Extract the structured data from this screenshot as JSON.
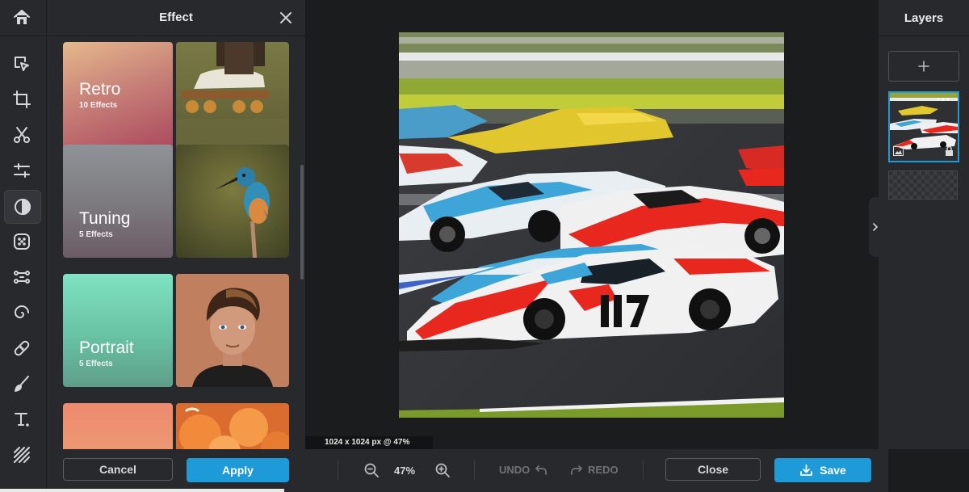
{
  "effect_panel": {
    "title": "Effect",
    "categories": [
      {
        "name": "Retro",
        "count": "10 Effects"
      },
      {
        "name": "Tuning",
        "count": "5 Effects"
      },
      {
        "name": "Portrait",
        "count": "5 Effects"
      }
    ],
    "cancel_label": "Cancel",
    "apply_label": "Apply"
  },
  "canvas": {
    "dimensions_label": "1024 x 1024 px @ 47%"
  },
  "toolbar": {
    "zoom": "47%",
    "undo_label": "UNDO",
    "redo_label": "REDO",
    "close_label": "Close",
    "save_label": "Save"
  },
  "layers_panel": {
    "title": "Layers"
  },
  "rail_tools": [
    "home-icon",
    "select-icon",
    "crop-icon",
    "cut-icon",
    "adjust-icon",
    "effect-icon",
    "texture-icon",
    "shapes-icon",
    "swirl-icon",
    "bandage-icon",
    "brush-icon",
    "text-icon",
    "pattern-icon"
  ],
  "colors": {
    "accent": "#1f9ad8",
    "panel": "#27292c",
    "stage": "#1b1c1e"
  }
}
